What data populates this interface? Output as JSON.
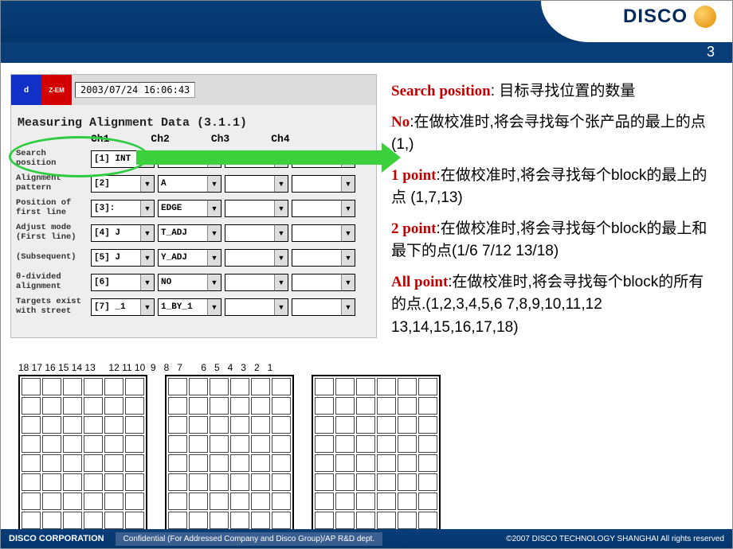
{
  "brand": "DISCO",
  "page_number": "3",
  "timestamp": "2003/07/24 16:06:43",
  "icon2_label": "Z-EM",
  "shot_title": "Measuring Alignment Data (3.1.1)",
  "channels": [
    "Ch1",
    "Ch2",
    "Ch3",
    "Ch4"
  ],
  "rows": [
    {
      "label": "Search\nposition",
      "v": [
        "[1] INT",
        "",
        " ",
        " "
      ]
    },
    {
      "label": "Alignment\npattern",
      "v": [
        "[2]",
        "A",
        " ",
        " "
      ]
    },
    {
      "label": "Position of\nfirst line",
      "v": [
        "[3]:",
        "EDGE",
        " ",
        " "
      ]
    },
    {
      "label": "Adjust mode\n(First line)",
      "v": [
        "[4] J",
        "T_ADJ",
        " ",
        " "
      ]
    },
    {
      "label": "(Subsequent)",
      "v": [
        "[5] J",
        "Y_ADJ",
        " ",
        " "
      ]
    },
    {
      "label": "θ-divided\nalignment",
      "v": [
        "[6]",
        "NO",
        " ",
        " "
      ]
    },
    {
      "label": "Targets exist\nwith street",
      "v": [
        "[7] _1",
        "1_BY_1",
        " ",
        " "
      ]
    }
  ],
  "block_numbers": "18 17 16 15 14 13     12 11 10  9   8   7       6   5   4   3   2   1",
  "notes": {
    "sp": {
      "term": "Search position",
      "rest": ": 目标寻找位置的数量"
    },
    "no": {
      "term": "No",
      "rest": ":在做校准时,将会寻找每个张产品的最上的点 (1,)"
    },
    "p1": {
      "term": "1 point",
      "rest": ":在做校准时,将会寻找每个block的最上的点 (1,7,13)"
    },
    "p2": {
      "term": "2 point",
      "rest": ":在做校准时,将会寻找每个block的最上和最下的点(1/6   7/12   13/18)"
    },
    "all": {
      "term": "All point",
      "rest": ":在做校准时,将会寻找每个block的所有的点.(1,2,3,4,5,6     7,8,9,10,11,12     13,14,15,16,17,18)"
    }
  },
  "footer": {
    "corp": "DISCO CORPORATION",
    "conf": "Confidential (For Addressed Company and Disco Group)/AP R&D dept.",
    "right": "©2007 DISCO TECHNOLOGY SHANGHAI  All rights reserved"
  }
}
